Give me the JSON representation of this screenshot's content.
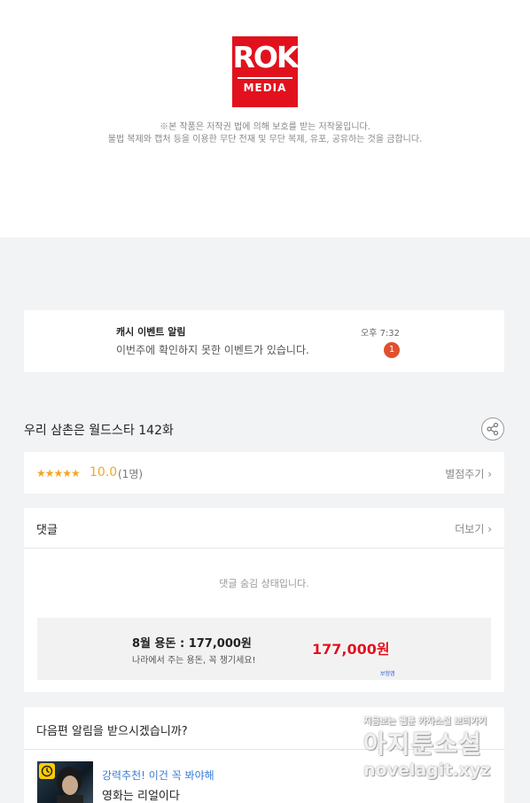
{
  "logo": {
    "line1": "ROK",
    "line2": "MEDIA"
  },
  "copyright": {
    "line1": "※본 작품은 저작권 법에 의해 보호를 받는 저작물입니다.",
    "line2": "불법 복제와 캡처 등을 이용한 무단 전재 및 무단 복제, 유포, 공유하는 것을 금합니다."
  },
  "notification": {
    "title": "캐시 이벤트 알림",
    "time": "오후 7:32",
    "message": "이번주에 확인하지 못한 이벤트가 있습니다.",
    "count": "1"
  },
  "episode": {
    "title": "우리 삼촌은 월드스타 142화"
  },
  "rating": {
    "stars": "★★★★★",
    "score": "10.0",
    "count": "(1명)",
    "rate_link": "별점주기 ›"
  },
  "comments": {
    "header": "댓글",
    "more": "더보기 ›",
    "hidden_msg": "댓글 숨김 상태입니다.",
    "ad": {
      "title": "8월 용돈 : 177,000원",
      "subtitle": "나라에서 주는 용돈, 꼭 챙기세요!",
      "amount": "177,000원",
      "tag": "보험앱"
    }
  },
  "next_alert": {
    "question": "다음편 알림을 받으시겠습니까?"
  },
  "recommend": {
    "tag": "강력추천! 이건 꼭 봐야해",
    "title": "영화는 리얼이다"
  },
  "watermark": {
    "line1": "지금보는 웹툰 카자소설 보러가기",
    "line2": "아지툰소설",
    "line3": "novelagit.xyz"
  },
  "colors": {
    "accent": "#e1121e",
    "rating": "#f5a623",
    "badge": "#e1502e",
    "recommend_tag": "#3a7bd5"
  }
}
